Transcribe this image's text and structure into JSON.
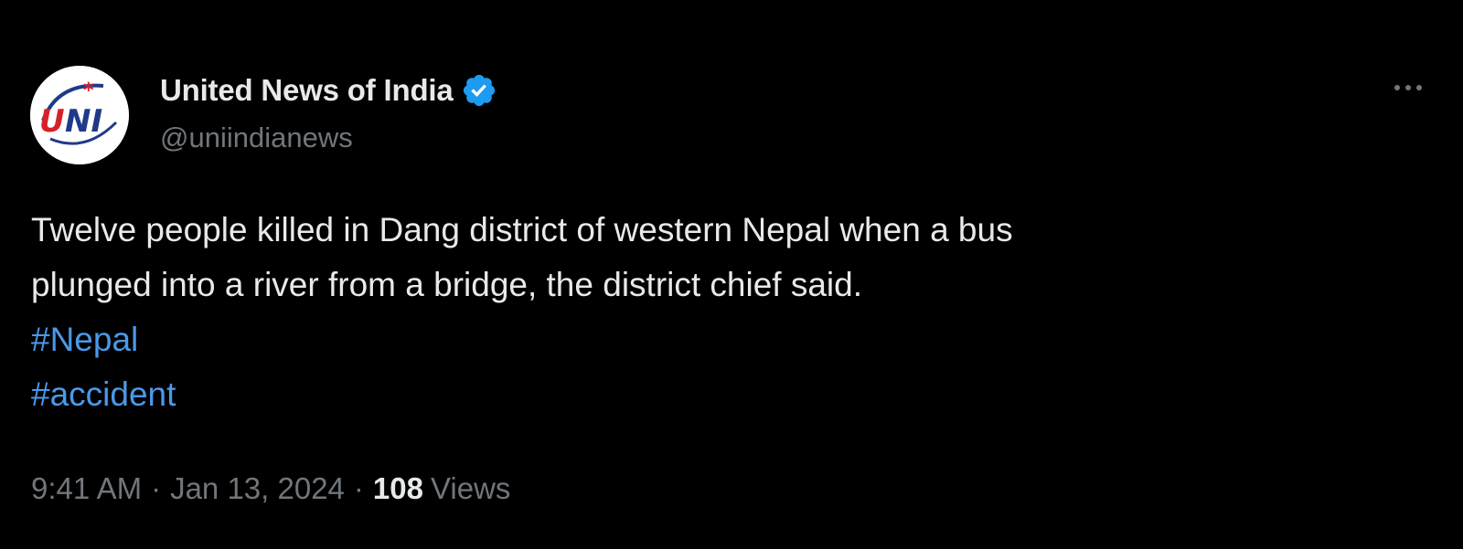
{
  "author": {
    "display_name": "United News of India",
    "handle": "@uniindianews",
    "verified": true,
    "avatar_logo_text": "UNI",
    "verified_color": "#1d9bf0"
  },
  "tweet": {
    "text_line_1": "Twelve people killed in Dang district of western Nepal when a bus",
    "text_line_2": "plunged into a river from a bridge, the district chief said.",
    "hashtags": [
      "#Nepal",
      "#accident"
    ],
    "hashtag_color": "#4a99e9"
  },
  "meta": {
    "time": "9:41 AM",
    "separator": "·",
    "date": "Jan 13, 2024",
    "views_count": "108",
    "views_label": "Views"
  },
  "icons": {
    "more": "more-options-icon",
    "verified": "verified-badge-icon"
  }
}
